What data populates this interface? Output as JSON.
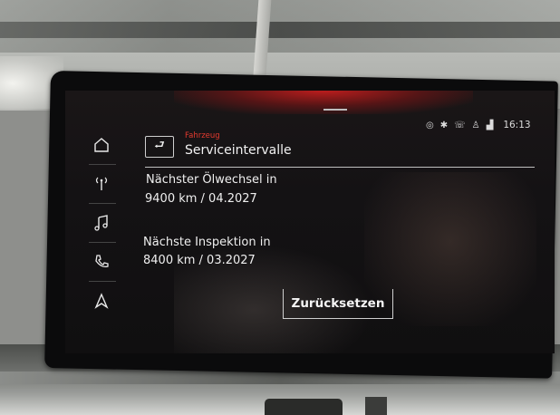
{
  "status_bar": {
    "icons": [
      "location-icon",
      "bluetooth-icon",
      "phone-muted-icon",
      "person-icon",
      "signal-icon"
    ],
    "time": "16:13"
  },
  "sidebar": {
    "items": [
      {
        "name": "home-icon"
      },
      {
        "name": "radio-icon"
      },
      {
        "name": "music-icon"
      },
      {
        "name": "phone-icon"
      },
      {
        "name": "navigation-icon"
      }
    ]
  },
  "header": {
    "breadcrumb": "Fahrzeug",
    "title": "Serviceintervalle"
  },
  "service": {
    "oil_label": "Nächster Ölwechsel in",
    "oil_value": "9400 km / 04.2027",
    "inspection_label": "Nächste Inspektion in",
    "inspection_value": "8400 km / 03.2027"
  },
  "actions": {
    "reset_label": "Zurücksetzen"
  },
  "colors": {
    "accent": "#e33a2f",
    "screen_bg": "#141214",
    "text": "#efefef"
  }
}
